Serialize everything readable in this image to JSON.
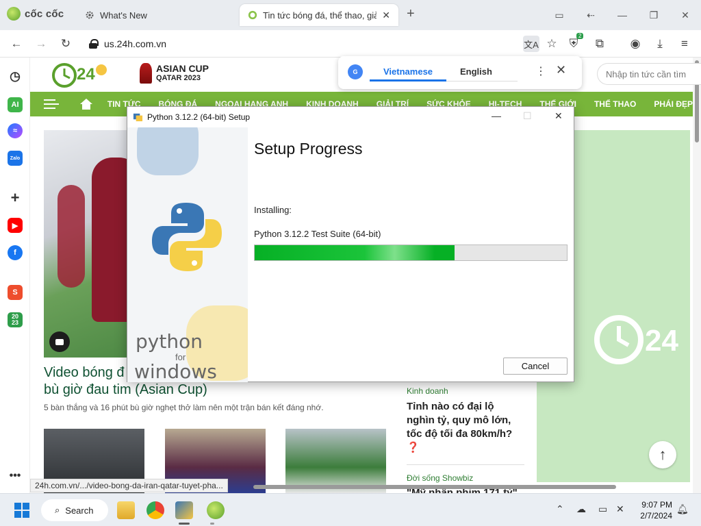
{
  "browser": {
    "brand": "cốc cốc",
    "tabs": [
      {
        "title": "What's New"
      },
      {
        "title": "Tin tức bóng đá, thể thao, giả"
      }
    ],
    "url": "us.24h.com.vn",
    "extension_badge": "2"
  },
  "sidebar": {
    "icons": [
      "history-icon",
      "ai-icon",
      "messenger-icon",
      "zalo-icon",
      "add-icon",
      "youtube-icon",
      "facebook-icon",
      "shopee-icon",
      "calendar-icon",
      "more-icon"
    ],
    "ai_label": "AI",
    "zalo_label": "Zalo",
    "calendar_label": "20\n23"
  },
  "site": {
    "asian_cup": {
      "line1": "ASIAN CUP",
      "line2": "QATAR 2023"
    },
    "nav": [
      "TIN TỨC",
      "BÓNG ĐÁ",
      "NGOẠI HẠNG ANH",
      "KINH DOANH",
      "GIẢI TRÍ",
      "SỨC KHỎE",
      "HI-TECH",
      "THẾ GIỚI",
      "THỂ THAO",
      "PHÁI ĐẸP"
    ],
    "search_placeholder": "Nhập tin tức cần tìm",
    "headline": "Video bóng đá Iran - Qatar: Cao trào bù giờ đau tim (Asian Cup)",
    "headline_visible_start": "Video bóng đ",
    "headline_line2": "bù giờ đau tim (Asian Cup)",
    "summary": "5 bàn thắng và 16 phút bù giờ nghẹt thở làm nên một trận bán kết đáng nhớ.",
    "side_news": [
      {
        "category": "Kinh doanh",
        "title": "Tỉnh nào có đại lộ nghìn tỷ, quy mô lớn, tốc độ tối đa 80km/h?"
      },
      {
        "category": "Đời sống Showbiz",
        "title": "\"Mỹ nhân phim 171 tỷ\""
      }
    ],
    "status_link": "24h.com.vn/.../video-bong-da-iran-qatar-tuyet-pha..."
  },
  "translate_popup": {
    "source_lang": "Vietnamese",
    "target_lang": "English"
  },
  "installer": {
    "title": "Python 3.12.2 (64-bit) Setup",
    "heading": "Setup Progress",
    "status_label": "Installing:",
    "current_item": "Python 3.12.2 Test Suite (64-bit)",
    "progress": 0.64,
    "cancel_label": "Cancel",
    "brand_python": "python",
    "brand_for": "for",
    "brand_windows": "windows"
  },
  "taskbar": {
    "search_label": "Search",
    "time": "9:07 PM",
    "date": "2/7/2024"
  },
  "colors": {
    "nav_green": "#78b53a",
    "progress_green": "#06b025",
    "link_blue": "#1a73e8",
    "headline_green": "#0f5132"
  }
}
